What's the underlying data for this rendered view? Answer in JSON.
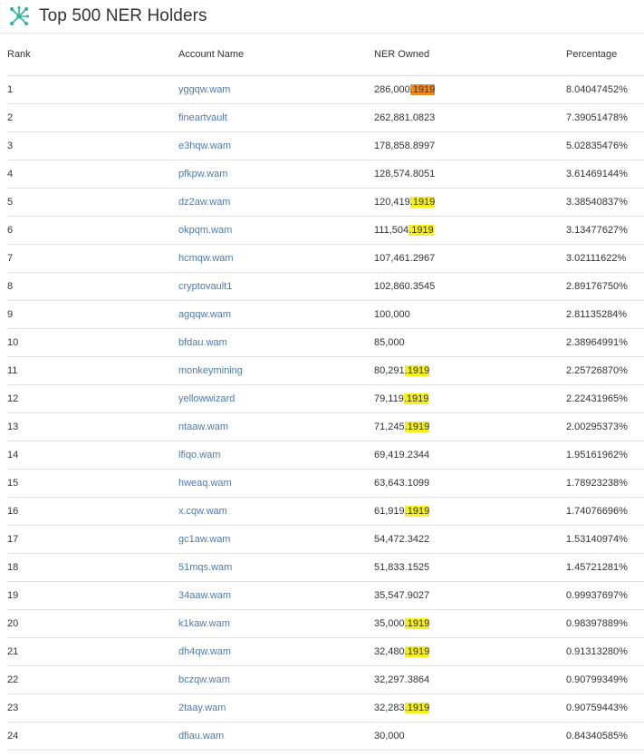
{
  "page": {
    "title": "Top 500 NER Holders",
    "highlight_term": ".1919"
  },
  "colors": {
    "link": "#4d7ab0",
    "highlight": "#f5ef1e",
    "highlight_current": "#f08a24",
    "logo": "#2bb5a0"
  },
  "table": {
    "headers": {
      "rank": "Rank",
      "account": "Account Name",
      "owned": "NER Owned",
      "percentage": "Percentage"
    },
    "rows": [
      {
        "rank": "1",
        "account": "yggqw.wam",
        "owned": "286,000.1919",
        "percentage": "8.04047452%"
      },
      {
        "rank": "2",
        "account": "fineartvault",
        "owned": "262,881.0823",
        "percentage": "7.39051478%"
      },
      {
        "rank": "3",
        "account": "e3hqw.wam",
        "owned": "178,858.8997",
        "percentage": "5.02835476%"
      },
      {
        "rank": "4",
        "account": "pfkpw.wam",
        "owned": "128,574.8051",
        "percentage": "3.61469144%"
      },
      {
        "rank": "5",
        "account": "dz2aw.wam",
        "owned": "120,419.1919",
        "percentage": "3.38540837%"
      },
      {
        "rank": "6",
        "account": "okpqm.wam",
        "owned": "111,504.1919",
        "percentage": "3.13477627%"
      },
      {
        "rank": "7",
        "account": "hcmqw.wam",
        "owned": "107,461.2967",
        "percentage": "3.02111622%"
      },
      {
        "rank": "8",
        "account": "cryptovault1",
        "owned": "102,860.3545",
        "percentage": "2.89176750%"
      },
      {
        "rank": "9",
        "account": "agqqw.wam",
        "owned": "100,000",
        "percentage": "2.81135284%"
      },
      {
        "rank": "10",
        "account": "bfdau.wam",
        "owned": "85,000",
        "percentage": "2.38964991%"
      },
      {
        "rank": "11",
        "account": "monkeymining",
        "owned": "80,291.1919",
        "percentage": "2.25726870%"
      },
      {
        "rank": "12",
        "account": "yellowwizard",
        "owned": "79,119.1919",
        "percentage": "2.22431965%"
      },
      {
        "rank": "13",
        "account": "ntaaw.wam",
        "owned": "71,245.1919",
        "percentage": "2.00295373%"
      },
      {
        "rank": "14",
        "account": "lfiqo.wam",
        "owned": "69,419.2344",
        "percentage": "1.95161962%"
      },
      {
        "rank": "15",
        "account": "hweaq.wam",
        "owned": "63,643.1099",
        "percentage": "1.78923238%"
      },
      {
        "rank": "16",
        "account": "x.cqw.wam",
        "owned": "61,919.1919",
        "percentage": "1.74076696%"
      },
      {
        "rank": "17",
        "account": "gc1aw.wam",
        "owned": "54,472.3422",
        "percentage": "1.53140974%"
      },
      {
        "rank": "18",
        "account": "51mqs.wam",
        "owned": "51,833.1525",
        "percentage": "1.45721281%"
      },
      {
        "rank": "19",
        "account": "34aaw.wam",
        "owned": "35,547.9027",
        "percentage": "0.99937697%"
      },
      {
        "rank": "20",
        "account": "k1kaw.wam",
        "owned": "35,000.1919",
        "percentage": "0.98397889%"
      },
      {
        "rank": "21",
        "account": "dh4qw.wam",
        "owned": "32,480.1919",
        "percentage": "0.91313280%"
      },
      {
        "rank": "22",
        "account": "bczqw.wam",
        "owned": "32,297.3864",
        "percentage": "0.90799349%"
      },
      {
        "rank": "23",
        "account": "2taay.wam",
        "owned": "32,283.1919",
        "percentage": "0.90759443%"
      },
      {
        "rank": "24",
        "account": "dfiau.wam",
        "owned": "30,000",
        "percentage": "0.84340585%"
      }
    ]
  }
}
